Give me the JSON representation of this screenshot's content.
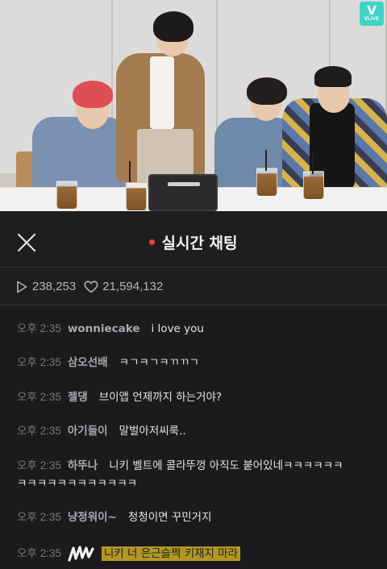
{
  "video": {
    "logo": {
      "icon": "v-icon",
      "label": "VLIVE",
      "color": "#3fd3c8"
    }
  },
  "header": {
    "close_icon": "close-icon",
    "live_dot_color": "#e8453c",
    "title": "실시간 채팅"
  },
  "stats": {
    "plays_icon": "play-icon",
    "plays": "238,253",
    "likes_icon": "heart-icon",
    "likes": "21,594,132"
  },
  "chat": {
    "messages": [
      {
        "time": "오후 2:35",
        "user": "wonniecake",
        "text": "i love you"
      },
      {
        "time": "오후 2:35",
        "user": "삼오선배",
        "text": "ㅋㄱㅋㄱㅋㄲㄲㄱ"
      },
      {
        "time": "오후 2:35",
        "user": "젤댕",
        "text": "브이앱 언제까지 하는거야?"
      },
      {
        "time": "오후 2:35",
        "user": "아기들이",
        "text": "말벌아저씨룩.."
      },
      {
        "time": "오후 2:35",
        "user": "하뚜나",
        "text": "니키 벨트에 콜라뚜껑 아직도 붙어있네ㅋㅋㅋㅋㅋㅋ",
        "text2": "ㅋㅋㅋㅋㅋㅋㅋㅋㅋㅋㅋㅋ"
      },
      {
        "time": "오후 2:35",
        "user": "냥정워이~",
        "text": "청청이면 꾸민거지"
      },
      {
        "time": "오후 2:35",
        "user_icon": "scribble-icon",
        "text": "니키 너 은근슬쩍 키재지 마라",
        "highlight_color": "#b39624"
      }
    ]
  }
}
